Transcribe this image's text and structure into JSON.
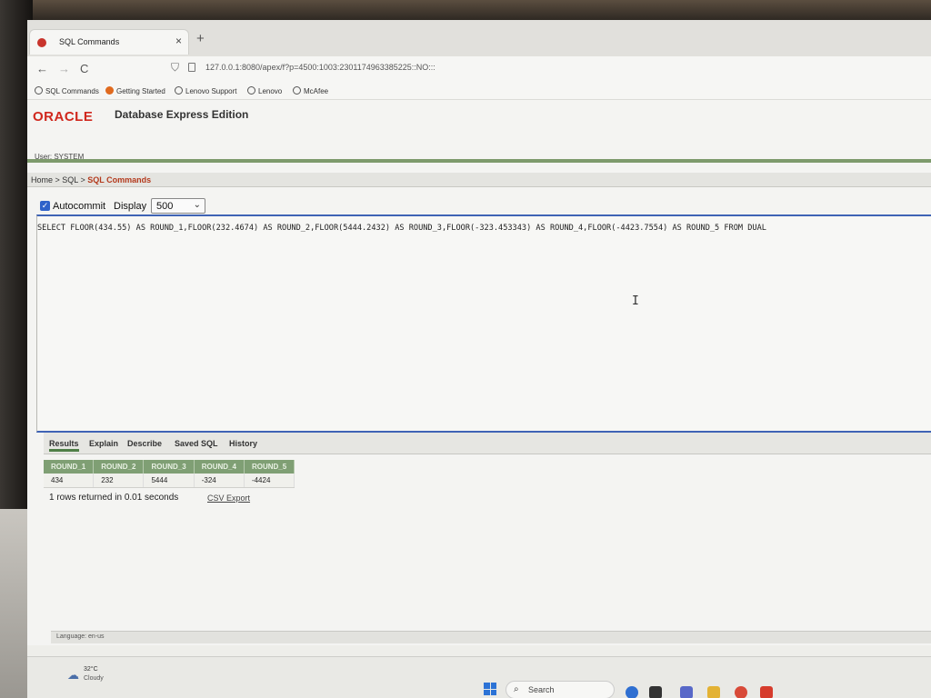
{
  "browser": {
    "tab_title": "SQL Commands",
    "tab_close": "×",
    "new_tab": "+",
    "back": "←",
    "forward": "→",
    "reload": "C",
    "url": "127.0.0.1:8080/apex/f?p=4500:1003:2301174963385225::NO:::",
    "bookmarks": [
      "SQL Commands",
      "Getting Started",
      "Lenovo Support",
      "Lenovo",
      "McAfee"
    ]
  },
  "apex": {
    "brand": "ORACLE",
    "product": "Database Express Edition",
    "user": "User: SYSTEM",
    "breadcrumb": {
      "home": "Home",
      "sep1": " > ",
      "sql": "SQL",
      "sep2": " > ",
      "current": "SQL Commands"
    }
  },
  "editor": {
    "autocommit_checked": "✓",
    "autocommit_label": "Autocommit",
    "display_label": "Display",
    "display_value": "500",
    "display_caret": "⌄",
    "sql": "SELECT FLOOR(434.55) AS ROUND_1,FLOOR(232.4674) AS ROUND_2,FLOOR(5444.2432) AS ROUND_3,FLOOR(-323.453343) AS ROUND_4,FLOOR(-4423.7554) AS ROUND_5 FROM DUAL",
    "cursor": "I"
  },
  "results_tabs": [
    "Results",
    "Explain",
    "Describe",
    "Saved SQL",
    "History"
  ],
  "results": {
    "columns": [
      "ROUND_1",
      "ROUND_2",
      "ROUND_3",
      "ROUND_4",
      "ROUND_5"
    ],
    "rows": [
      [
        "434",
        "232",
        "5444",
        "-324",
        "-4424"
      ]
    ],
    "summary": "1 rows returned in 0.01 seconds",
    "csv_export": "CSV Export"
  },
  "footer": {
    "language": "Language: en-us"
  },
  "taskbar": {
    "weather_icon": "☁",
    "temperature": "32°C",
    "weather": "Cloudy",
    "search_glyph": "⌕",
    "search_label": "Search"
  },
  "colors": {
    "oracle_red": "#d0271d",
    "header_green": "#7f9f74",
    "editor_border": "#3f63b5"
  }
}
